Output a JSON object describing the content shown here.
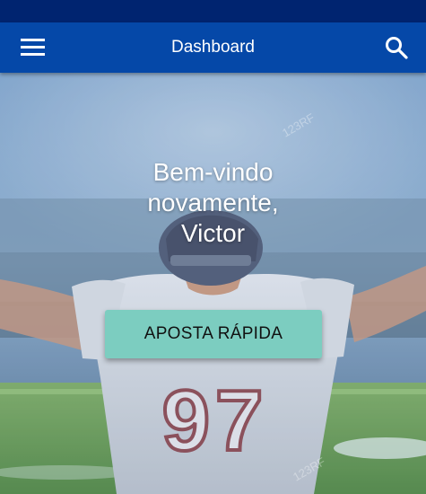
{
  "app_bar": {
    "title": "Dashboard",
    "menu_icon": "hamburger-menu-icon",
    "search_icon": "search-icon"
  },
  "hero": {
    "welcome_lines": [
      "Bem-vindo",
      "novamente,",
      "Victor"
    ],
    "quick_bet_label": "APOSTA RÁPIDA",
    "jersey_number": "97",
    "watermark": "123RF"
  },
  "colors": {
    "status_bar": "#002470",
    "app_bar": "#0548a8",
    "button": "#7ccdc0"
  }
}
